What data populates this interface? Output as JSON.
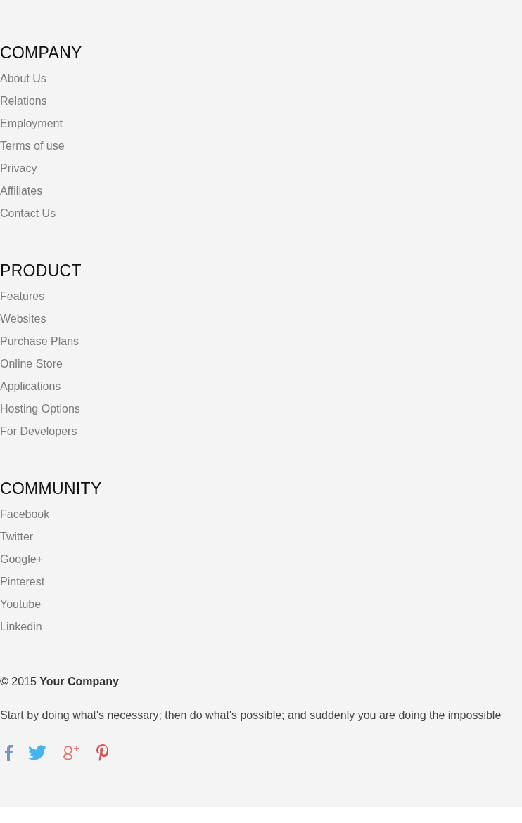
{
  "sections": [
    {
      "heading": "COMPANY",
      "links": [
        "About Us",
        "Relations",
        "Employment",
        "Terms of use",
        "Privacy",
        "Affiliates",
        "Contact Us"
      ]
    },
    {
      "heading": "PRODUCT",
      "links": [
        "Features",
        "Websites",
        "Purchase Plans",
        "Online Store",
        "Applications",
        "Hosting Options",
        "For Developers"
      ]
    },
    {
      "heading": "COMMUNITY",
      "links": [
        "Facebook",
        "Twitter",
        "Google+",
        "Pinterest",
        "Youtube",
        "Linkedin"
      ]
    }
  ],
  "copyright": "© 2015 **Your Company**",
  "quote": "Start by doing what's necessary; then do what's possible; and suddenly you are doing the impossible",
  "social_icons": [
    {
      "kind": "facebook"
    },
    {
      "kind": "twitter"
    },
    {
      "kind": "googleplus"
    },
    {
      "kind": "pinterest"
    }
  ]
}
